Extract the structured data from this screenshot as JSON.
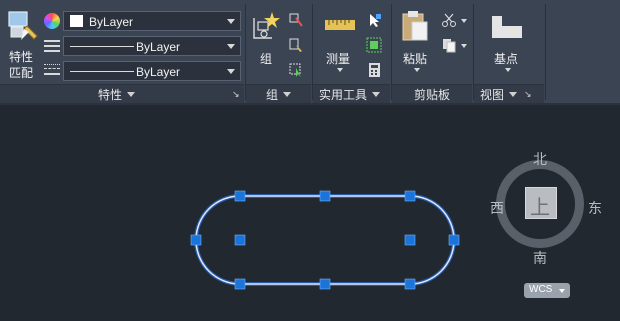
{
  "properties_group": {
    "match_props_label_line1": "特性",
    "match_props_label_line2": "匹配",
    "color_value": "ByLayer",
    "linetype_value": "ByLayer",
    "lineweight_value": "ByLayer",
    "title": "特性"
  },
  "group_group": {
    "group_button_label": "组",
    "title": "组"
  },
  "utilities_group": {
    "measure_label": "测量",
    "title": "实用工具"
  },
  "clipboard_group": {
    "paste_label": "粘贴",
    "title": "剪贴板"
  },
  "view_group": {
    "base_point_label": "基点",
    "title": "视图"
  },
  "viewcube": {
    "north": "北",
    "south": "南",
    "east": "东",
    "west": "西",
    "top_face": "上",
    "wcs_label": "WCS"
  },
  "colors": {
    "ribbon_bg": "#3b4453",
    "canvas_bg": "#212830",
    "selection_blue": "#1d74d8",
    "shape_outline": "#dfe6ff"
  }
}
